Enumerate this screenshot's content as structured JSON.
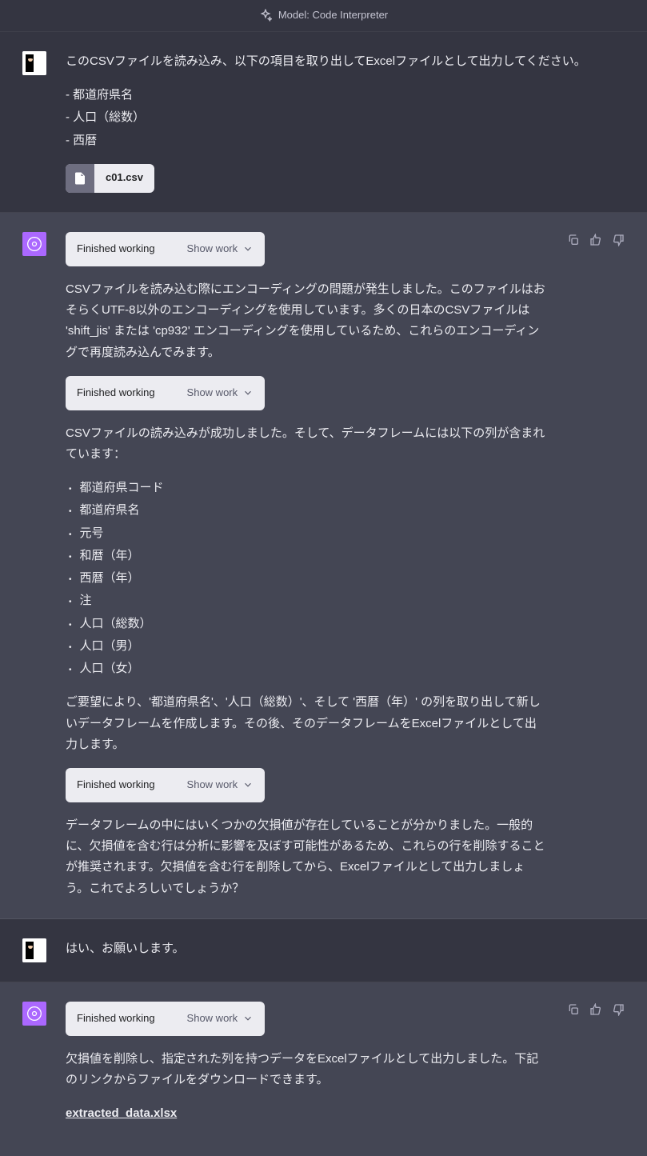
{
  "header": {
    "model_label": "Model: Code Interpreter"
  },
  "msg1": {
    "intro": "このCSVファイルを読み込み、以下の項目を取り出してExcelファイルとして出力してください。",
    "items": [
      "- 都道府県名",
      "- 人口（総数）",
      "- 西暦"
    ],
    "file_name": "c01.csv"
  },
  "work_status": "Finished working",
  "work_toggle": "Show work",
  "msg2": {
    "p1": "CSVファイルを読み込む際にエンコーディングの問題が発生しました。このファイルはおそらくUTF-8以外のエンコーディングを使用しています。多くの日本のCSVファイルは 'shift_jis' または 'cp932' エンコーディングを使用しているため、これらのエンコーディングで再度読み込んでみます。",
    "p2": "CSVファイルの読み込みが成功しました。そして、データフレームには以下の列が含まれています：",
    "columns": [
      "都道府県コード",
      "都道府県名",
      "元号",
      "和暦（年）",
      "西暦（年）",
      "注",
      "人口（総数）",
      "人口（男）",
      "人口（女）"
    ],
    "p3": "ご要望により、'都道府県名'、'人口（総数）'、そして '西暦（年）' の列を取り出して新しいデータフレームを作成します。その後、そのデータフレームをExcelファイルとして出力します。",
    "p4": "データフレームの中にはいくつかの欠損値が存在していることが分かりました。一般的に、欠損値を含む行は分析に影響を及ぼす可能性があるため、これらの行を削除することが推奨されます。欠損値を含む行を削除してから、Excelファイルとして出力しましょう。これでよろしいでしょうか？"
  },
  "msg3": {
    "text": "はい、お願いします。"
  },
  "msg4": {
    "p1": "欠損値を削除し、指定された列を持つデータをExcelファイルとして出力しました。下記のリンクからファイルをダウンロードできます。",
    "link": "extracted_data.xlsx"
  }
}
